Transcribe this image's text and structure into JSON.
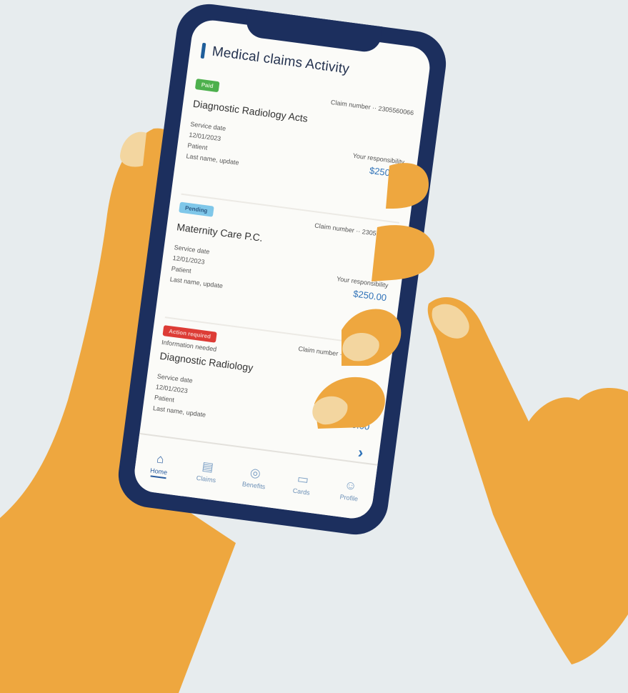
{
  "screen": {
    "title": "Medical claims Activity"
  },
  "claims": [
    {
      "status": "Paid",
      "claim_meta": "Claim number ·· 2305560066",
      "patient": "Diagnostic Radiology Acts",
      "details": [
        "Service date",
        "12/01/2023",
        "Patient",
        "Last name, update"
      ],
      "responsibility_label": "Your responsibility",
      "amount": "$250.21",
      "status_color": "#4db04d"
    },
    {
      "status": "Pending",
      "claim_meta": "Claim number ·· 2305560068",
      "patient": "Maternity Care P.C.",
      "details": [
        "Service date",
        "12/01/2023",
        "Patient",
        "Last name, update"
      ],
      "responsibility_label": "Your responsibility",
      "amount": "$250.00",
      "status_color": "#7fc7e9"
    },
    {
      "status": "Action required",
      "claim_meta": "Claim number ·· 2305560069",
      "patient": "Diagnostic Radiology",
      "sub": "Information needed",
      "details": [
        "Service date",
        "12/01/2023",
        "Patient",
        "Last name, update"
      ],
      "responsibility_label": "Your responsibility",
      "amount": "$250.00",
      "status_color": "#dd3c36"
    }
  ],
  "tabs": [
    {
      "label": "Home",
      "icon": "home-icon"
    },
    {
      "label": "Claims",
      "icon": "document-icon"
    },
    {
      "label": "Benefits",
      "icon": "shield-icon"
    },
    {
      "label": "Cards",
      "icon": "card-icon"
    },
    {
      "label": "Profile",
      "icon": "person-icon"
    }
  ],
  "colors": {
    "background": "#e7ecee",
    "phone_frame": "#1c2f5e",
    "skin": "#eea73f",
    "nail": "#f3d6a0",
    "accent": "#2f72b8"
  }
}
